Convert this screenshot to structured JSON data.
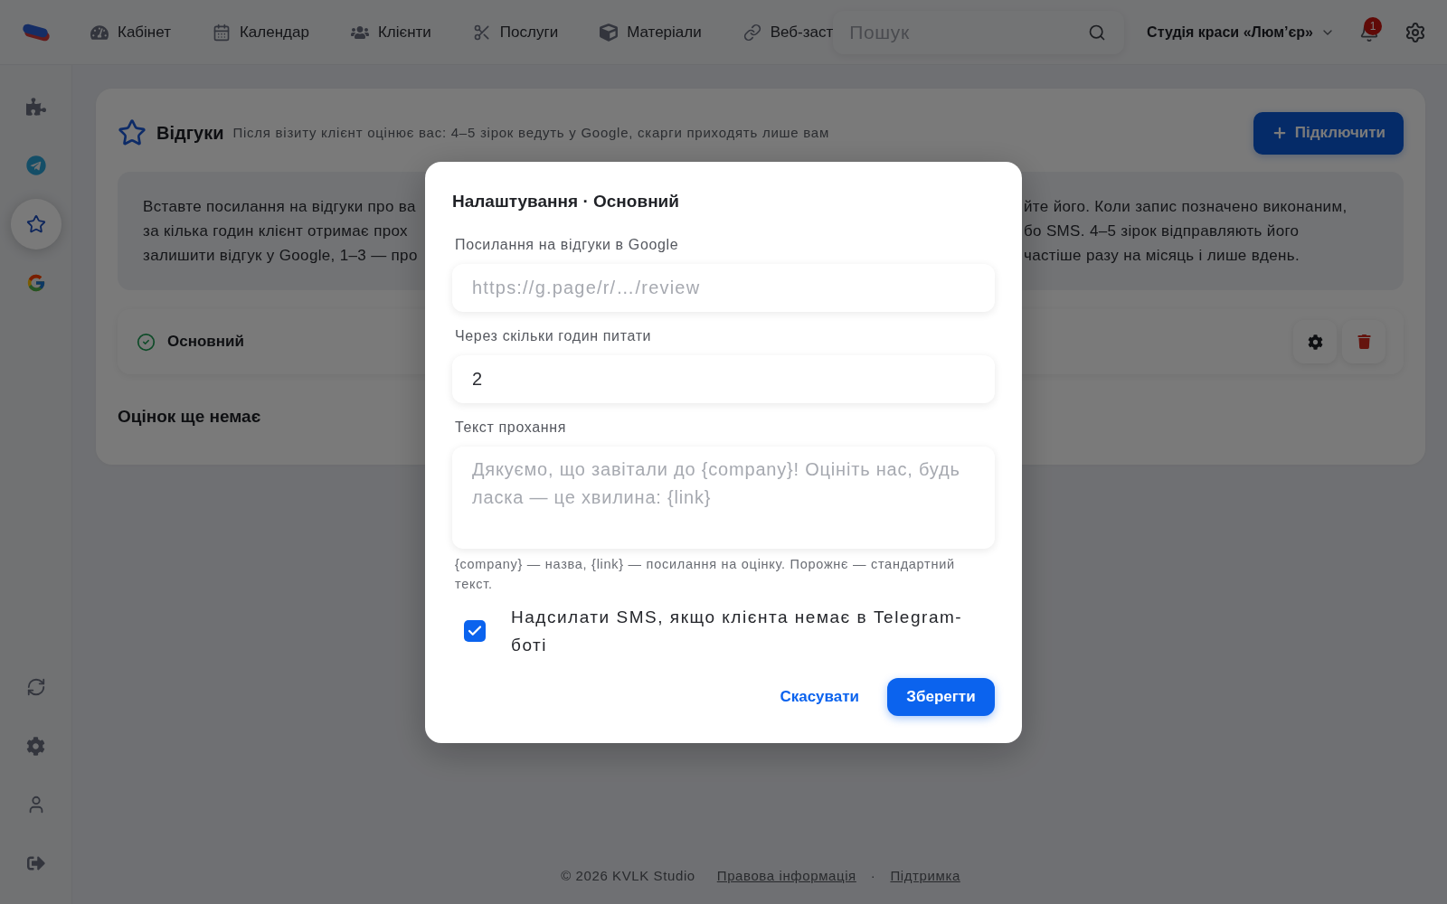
{
  "topbar": {
    "nav": [
      {
        "label": "Кабінет",
        "selected": false
      },
      {
        "label": "Календар",
        "selected": false
      },
      {
        "label": "Клієнти",
        "selected": false
      },
      {
        "label": "Послуги",
        "selected": false
      },
      {
        "label": "Матеріали",
        "selected": false
      },
      {
        "label": "Веб-заст",
        "selected": false
      }
    ],
    "search": {
      "placeholder": "Пошук"
    },
    "company": "Студія краси «Люм’єр»",
    "notification_count": "1"
  },
  "sidebar": {
    "items": [
      {
        "selected": false
      },
      {
        "selected": false
      },
      {
        "selected": true
      },
      {
        "selected": false
      }
    ]
  },
  "page": {
    "title": "Відгуки",
    "subtitle": "Після візиту клієнт оцінює вас: 4–5 зірок ведуть у Google, скарги приходять лише вам",
    "connect_button": "Підключити",
    "info_box": {
      "left_fragments": [
        "Вставте посилання на відгуки про ва",
        "за кілька годин клієнт отримає прох",
        "залишити відгук у Google, 1–3 — про"
      ],
      "right_fragments": [
        "йте його. Коли запис позначено виконаним,",
        "бо SMS. 4–5 зірок відправляють його",
        "частіше разу на місяць і лише вдень."
      ]
    },
    "integrations": [
      {
        "name": "Основний",
        "active": true
      }
    ],
    "empty_state": "Оцінок ще немає"
  },
  "modal": {
    "title": "Налаштування · Основний",
    "fields": [
      {
        "kind": "input",
        "label": "Посилання на відгуки в Google",
        "placeholder": "https://g.page/r/…/review"
      },
      {
        "kind": "input",
        "label": "Через скільки годин питати",
        "value": "2"
      },
      {
        "kind": "textarea",
        "label": "Текст прохання",
        "placeholder": "Дякуємо, що завітали до {company}! Оцініть нас, будь ласка — це хвилина: {link}"
      }
    ],
    "hint": "{company} — назва, {link} — посилання на оцінку. Порожнє — стандартний текст.",
    "sms_checkbox": {
      "label": "Надсилати SMS, якщо клієнта немає в Telegram-боті",
      "checked": true
    },
    "buttons": {
      "cancel": "Скасувати",
      "save": "Зберегти"
    }
  },
  "footer": {
    "copyright": "© 2026 KVLK Studio",
    "links": [
      "Правова інформація",
      "Підтримка"
    ],
    "separator": "·"
  }
}
